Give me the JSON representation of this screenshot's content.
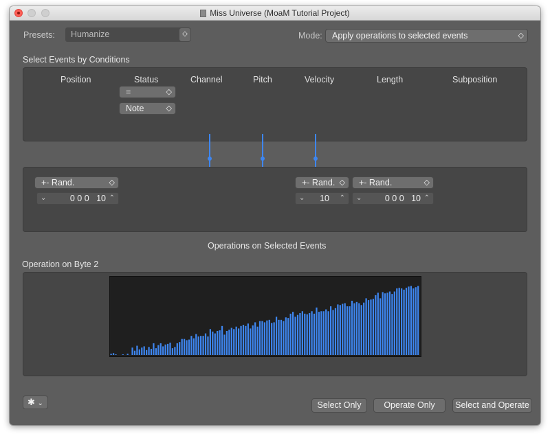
{
  "window": {
    "title": "Miss Universe (MoaM Tutorial Project)"
  },
  "presets": {
    "label": "Presets:",
    "value": "Humanize"
  },
  "mode": {
    "label": "Mode:",
    "value": "Apply operations to selected events"
  },
  "conditions": {
    "heading": "Select Events by Conditions",
    "columns": [
      "Position",
      "Status",
      "Channel",
      "Pitch",
      "Velocity",
      "Length",
      "Subposition"
    ],
    "status_operator": "=",
    "status_type": "Note"
  },
  "operations": {
    "heading": "Operations on Selected Events",
    "position": {
      "op": "+- Rand.",
      "value": "0 0 0   10"
    },
    "velocity": {
      "op": "+- Rand.",
      "value": "10"
    },
    "length": {
      "op": "+- Rand.",
      "value": "0 0 0   10"
    }
  },
  "byte2": {
    "heading": "Operation on Byte 2",
    "accent_color": "#3e86f0"
  },
  "chart_data": {
    "type": "bar",
    "title": "",
    "xlabel": "",
    "ylabel": "",
    "ylim": [
      0,
      127
    ],
    "x_count": 128,
    "values": [
      2,
      3,
      1,
      0,
      0,
      1,
      0,
      2,
      0,
      12,
      7,
      15,
      9,
      12,
      14,
      8,
      13,
      10,
      19,
      11,
      16,
      19,
      14,
      17,
      18,
      20,
      11,
      13,
      19,
      21,
      26,
      26,
      24,
      25,
      31,
      27,
      34,
      30,
      31,
      31,
      35,
      30,
      42,
      38,
      35,
      39,
      40,
      47,
      33,
      39,
      41,
      44,
      42,
      46,
      43,
      47,
      49,
      47,
      51,
      43,
      48,
      53,
      46,
      55,
      55,
      53,
      56,
      57,
      52,
      53,
      62,
      57,
      57,
      55,
      61,
      60,
      67,
      70,
      62,
      65,
      68,
      71,
      67,
      66,
      68,
      71,
      67,
      77,
      70,
      71,
      71,
      74,
      71,
      79,
      73,
      76,
      82,
      81,
      83,
      84,
      79,
      79,
      88,
      84,
      86,
      84,
      81,
      85,
      92,
      89,
      90,
      91,
      97,
      101,
      92,
      102,
      100,
      101,
      103,
      99,
      103,
      108,
      109,
      108,
      106,
      109,
      111,
      112,
      108,
      110,
      112
    ]
  },
  "bottom": {
    "select_only": "Select Only",
    "operate_only": "Operate Only",
    "select_and_operate": "Select and Operate"
  }
}
